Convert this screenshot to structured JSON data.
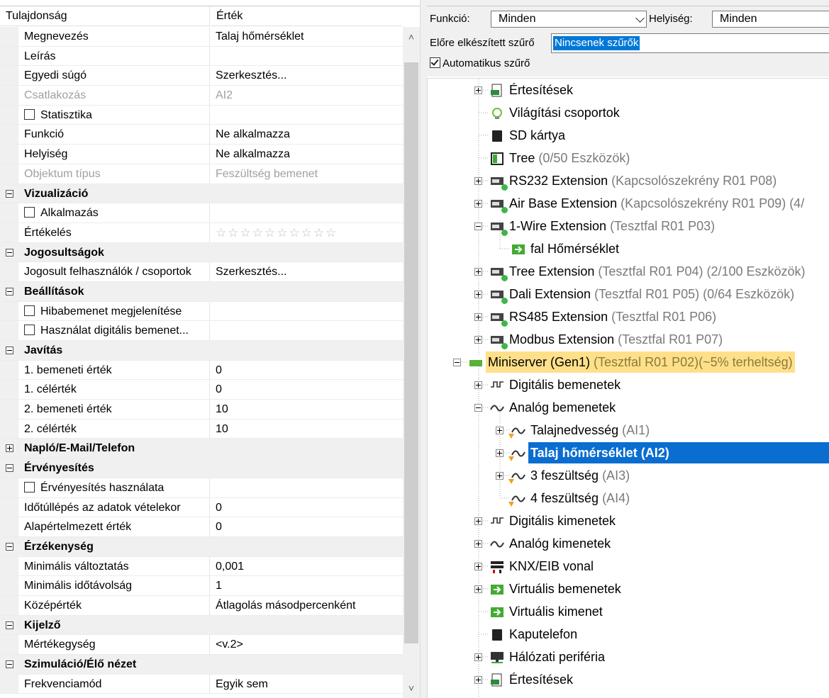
{
  "properties": {
    "header": {
      "name": "Tulajdonság",
      "value": "Érték"
    },
    "rows": [
      {
        "type": "prop",
        "name": "Megnevezés",
        "value": "Talaj hőmérséklet"
      },
      {
        "type": "prop",
        "name": "Leírás",
        "value": ""
      },
      {
        "type": "prop",
        "name": "Egyedi súgó",
        "value": "Szerkesztés..."
      },
      {
        "type": "prop",
        "name": "Csatlakozás",
        "value": "AI2",
        "disabled": true
      },
      {
        "type": "check",
        "name": "Statisztika",
        "value": ""
      },
      {
        "type": "prop",
        "name": "Funkció",
        "value": "Ne alkalmazza"
      },
      {
        "type": "prop",
        "name": "Helyiség",
        "value": "Ne alkalmazza"
      },
      {
        "type": "prop",
        "name": "Objektum típus",
        "value": "Feszültség bemenet",
        "disabled": true
      },
      {
        "type": "cat",
        "name": "Vizualizáció",
        "expanded": true
      },
      {
        "type": "check",
        "name": "Alkalmazás",
        "value": ""
      },
      {
        "type": "stars",
        "name": "Értékelés",
        "value": "☆☆☆☆☆☆☆☆☆☆"
      },
      {
        "type": "cat",
        "name": "Jogosultságok",
        "expanded": true
      },
      {
        "type": "prop",
        "name": "Jogosult felhasználók / csoportok",
        "value": "Szerkesztés..."
      },
      {
        "type": "cat",
        "name": "Beállítások",
        "expanded": true
      },
      {
        "type": "check",
        "name": "Hibabemenet megjelenítése",
        "value": ""
      },
      {
        "type": "check",
        "name": "Használat digitális bemenet...",
        "value": ""
      },
      {
        "type": "cat",
        "name": "Javítás",
        "expanded": true
      },
      {
        "type": "prop",
        "name": "1. bemeneti érték",
        "value": "0"
      },
      {
        "type": "prop",
        "name": "1. célérték",
        "value": "0"
      },
      {
        "type": "prop",
        "name": "2. bemeneti érték",
        "value": "10"
      },
      {
        "type": "prop",
        "name": "2. célérték",
        "value": "10"
      },
      {
        "type": "cat",
        "name": "Napló/E-Mail/Telefon",
        "expanded": false
      },
      {
        "type": "cat",
        "name": "Érvényesítés",
        "expanded": true
      },
      {
        "type": "check",
        "name": "Érvényesítés használata",
        "value": ""
      },
      {
        "type": "prop",
        "name": "Időtúllépés az adatok vételekor",
        "value": "0"
      },
      {
        "type": "prop",
        "name": "Alapértelmezett érték",
        "value": "0"
      },
      {
        "type": "cat",
        "name": "Érzékenység",
        "expanded": true
      },
      {
        "type": "prop",
        "name": "Minimális változtatás",
        "value": "0,001"
      },
      {
        "type": "prop",
        "name": "Minimális időtávolság",
        "value": "1"
      },
      {
        "type": "prop",
        "name": "Középérték",
        "value": "Átlagolás másodpercenként"
      },
      {
        "type": "cat",
        "name": "Kijelző",
        "expanded": true
      },
      {
        "type": "prop",
        "name": "Mértékegység",
        "value": "<v.2>"
      },
      {
        "type": "cat",
        "name": "Szimuláció/Élő nézet",
        "expanded": true
      },
      {
        "type": "prop",
        "name": "Frekvenciamód",
        "value": "Egyik sem"
      }
    ]
  },
  "filters": {
    "function_label": "Funkció:",
    "function_value": "Minden",
    "room_label": "Helyiség:",
    "room_value": "Minden",
    "preset_label": "Előre elkészített szűrő",
    "preset_value": "Nincsenek szűrők",
    "auto_label": "Automatikus szűrő"
  },
  "tree": [
    {
      "label": "Értesítések",
      "sub": "",
      "icon": "log-icon"
    },
    {
      "label": "Világítási csoportok",
      "sub": "",
      "icon": "light-group-icon"
    },
    {
      "label": "SD kártya",
      "sub": "",
      "icon": "sd-card-icon"
    },
    {
      "label": "Tree",
      "sub": " (0/50 Eszközök)",
      "icon": "tree-icon"
    },
    {
      "label": "RS232 Extension",
      "sub": " (Kapcsolószekrény R01 P08)",
      "icon": "extension-icon"
    },
    {
      "label": "Air Base Extension",
      "sub": " (Kapcsolószekrény R01 P09) (4/",
      "icon": "extension-icon"
    },
    {
      "label": "1-Wire Extension",
      "sub": " (Tesztfal R01 P03)",
      "icon": "extension-icon"
    },
    {
      "label": "fal Hőmérséklet",
      "sub": "",
      "icon": "virtual-input-icon"
    },
    {
      "label": "Tree Extension",
      "sub": " (Tesztfal R01 P04) (2/100 Eszközök)",
      "icon": "extension-icon"
    },
    {
      "label": "Dali Extension",
      "sub": " (Tesztfal R01 P05) (0/64 Eszközök)",
      "icon": "extension-icon"
    },
    {
      "label": "RS485 Extension",
      "sub": " (Tesztfal R01 P06)",
      "icon": "extension-icon"
    },
    {
      "label": "Modbus Extension",
      "sub": " (Tesztfal R01 P07)",
      "icon": "extension-icon"
    },
    {
      "label": "Miniserver (Gen1)",
      "sub": " (Tesztfal R01 P02)(~5% terheltség)",
      "icon": "miniserver-icon"
    },
    {
      "label": "Digitális bemenetek",
      "sub": "",
      "icon": "digital-input-icon"
    },
    {
      "label": "Analóg bemenetek",
      "sub": "",
      "icon": "analog-input-icon"
    },
    {
      "label": "Talajnedvesség",
      "sub": " (AI1)",
      "icon": "analog-input-icon"
    },
    {
      "label": "Talaj hőmérséklet (AI2)",
      "sub": "",
      "icon": "analog-input-icon"
    },
    {
      "label": "3 feszültség",
      "sub": " (AI3)",
      "icon": "analog-input-icon"
    },
    {
      "label": "4 feszültség",
      "sub": " (AI4)",
      "icon": "analog-input-icon"
    },
    {
      "label": "Digitális kimenetek",
      "sub": "",
      "icon": "digital-output-icon"
    },
    {
      "label": "Analóg kimenetek",
      "sub": "",
      "icon": "analog-output-icon"
    },
    {
      "label": "KNX/EIB vonal",
      "sub": "",
      "icon": "knx-icon"
    },
    {
      "label": "Virtuális bemenetek",
      "sub": "",
      "icon": "virtual-input-icon"
    },
    {
      "label": "Virtuális kimenet",
      "sub": "",
      "icon": "virtual-output-icon"
    },
    {
      "label": "Kaputelefon",
      "sub": "",
      "icon": "intercom-icon"
    },
    {
      "label": "Hálózati periféria",
      "sub": "",
      "icon": "network-icon"
    },
    {
      "label": "Értesítések",
      "sub": "",
      "icon": "log-icon"
    }
  ]
}
